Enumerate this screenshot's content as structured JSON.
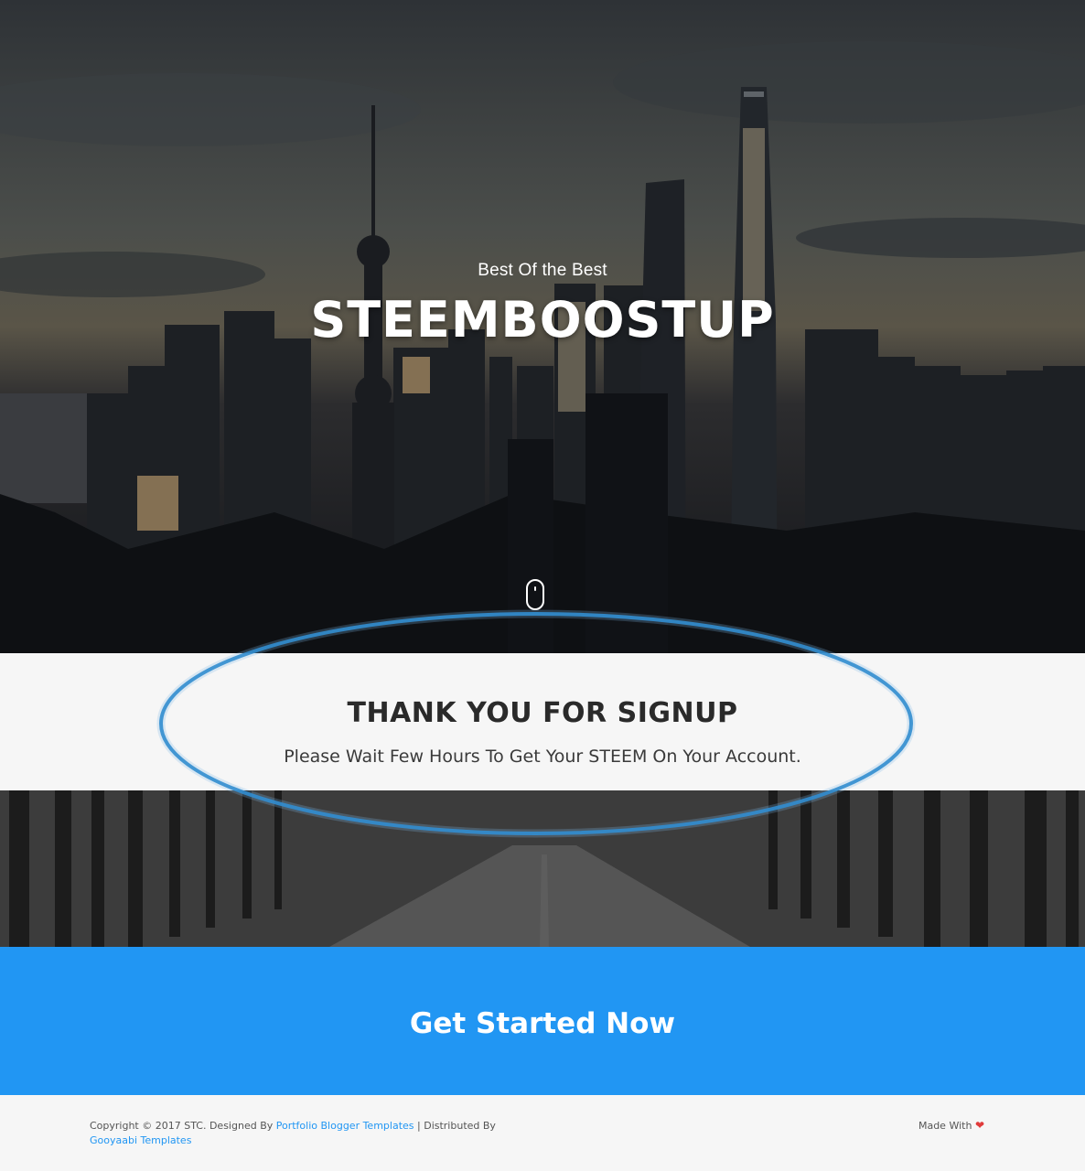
{
  "hero": {
    "tagline": "Best Of the Best",
    "title": "STEEMBOOSTUP",
    "scroll_icon": "mouse-scroll-icon"
  },
  "thanks": {
    "title": "THANK YOU FOR SIGNUP",
    "message": "Please Wait Few Hours To Get Your STEEM On Your Account."
  },
  "cta": {
    "label": "Get Started Now",
    "color": "#2196f3"
  },
  "footer": {
    "copyright_prefix": "Copyright © 2017 STC. Designed By",
    "designer_link": "Portfolio Blogger Templates",
    "separator": "| Distributed By",
    "distributor_link": "Gooyaabi Templates",
    "made_with": "Made With",
    "heart_icon": "heart-icon"
  },
  "annotation": {
    "color": "#1a7fc9"
  }
}
